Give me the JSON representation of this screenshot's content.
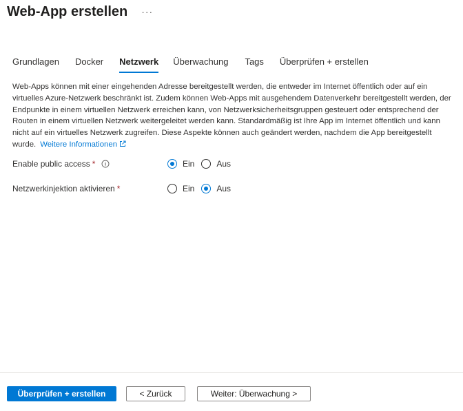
{
  "header": {
    "title": "Web-App erstellen",
    "more_label": "···"
  },
  "tabs": [
    {
      "label": "Grundlagen",
      "active": false
    },
    {
      "label": "Docker",
      "active": false
    },
    {
      "label": "Netzwerk",
      "active": true
    },
    {
      "label": "Überwachung",
      "active": false
    },
    {
      "label": "Tags",
      "active": false
    },
    {
      "label": "Überprüfen + erstellen",
      "active": false
    }
  ],
  "description": {
    "text": "Web-Apps können mit einer eingehenden Adresse bereitgestellt werden, die entweder im Internet öffentlich oder auf ein virtuelles Azure-Netzwerk beschränkt ist. Zudem können Web-Apps mit ausgehendem Datenverkehr bereitgestellt werden, der Endpunkte in einem virtuellen Netzwerk erreichen kann, von Netzwerksicherheitsgruppen gesteuert oder entsprechend der Routen in einem virtuellen Netzwerk weitergeleitet werden kann. Standardmäßig ist Ihre App im Internet öffentlich und kann nicht auf ein virtuelles Netzwerk zugreifen. Diese Aspekte können auch geändert werden, nachdem die App bereitgestellt wurde.",
    "link_label": "Weitere Informationen"
  },
  "form": {
    "public_access": {
      "label": "Enable public access",
      "required_mark": "*",
      "options": [
        "Ein",
        "Aus"
      ],
      "selected": "Ein"
    },
    "network_injection": {
      "label": "Netzwerkinjektion aktivieren",
      "required_mark": "*",
      "options": [
        "Ein",
        "Aus"
      ],
      "selected": "Aus"
    }
  },
  "footer": {
    "review_create_label": "Überprüfen + erstellen",
    "back_label": "< Zurück",
    "next_label": "Weiter: Überwachung >"
  },
  "colors": {
    "accent": "#0078d4",
    "required": "#a4262c",
    "text": "#323130"
  },
  "icons": {
    "more": "more-horizontal-icon",
    "info": "info-icon",
    "external_link": "external-link-icon"
  }
}
